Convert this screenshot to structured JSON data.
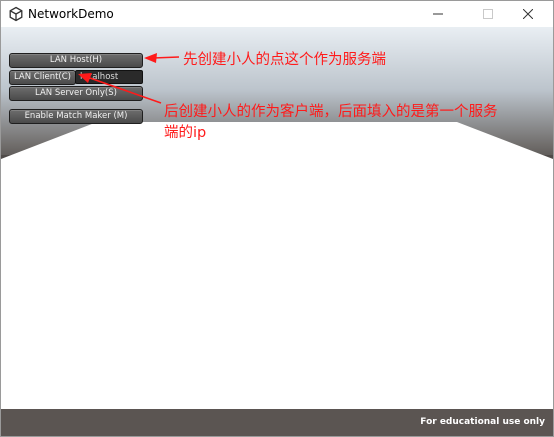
{
  "window": {
    "title": "NetworkDemo"
  },
  "menu": {
    "lan_host": "LAN Host(H)",
    "lan_client": "LAN Client(C)",
    "client_address": "localhost",
    "lan_server": "LAN Server Only(S)",
    "match_maker": "Enable Match Maker (M)"
  },
  "annotations": {
    "host_note": "先创建小人的点这个作为服务端",
    "client_note_line1": "后创建小人的作为客户端，后面填入的是第一个服务",
    "client_note_line2": "端的ip"
  },
  "footer": {
    "edu_text": "For educational use only"
  },
  "icons": {
    "app": "unity-icon",
    "minimize": "minimize-icon",
    "maximize": "maximize-icon",
    "close": "close-icon"
  },
  "colors": {
    "annotation": "#ff1a1a",
    "button_bg": "#5a5a5a",
    "ground": "#5b5552",
    "sky_top": "#e9eef3"
  }
}
